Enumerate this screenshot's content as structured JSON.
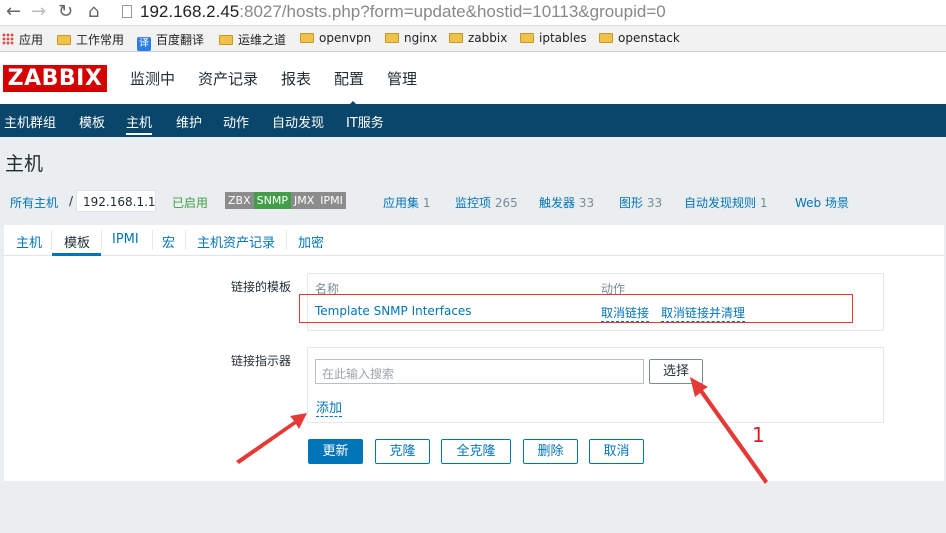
{
  "browser": {
    "url_host": "192.168.2.45",
    "url_rest": ":8027/hosts.php?form=update&hostid=10113&groupid=0",
    "bookmarks": [
      "应用",
      "工作常用",
      "百度翻译",
      "运维之道",
      "openvpn",
      "nginx",
      "zabbix",
      "iptables",
      "openstack"
    ]
  },
  "header": {
    "logo": "ZABBIX",
    "menu": [
      "监测中",
      "资产记录",
      "报表",
      "配置",
      "管理"
    ],
    "active_menu": "配置"
  },
  "submenu": {
    "items": [
      "主机群组",
      "模板",
      "主机",
      "维护",
      "动作",
      "自动发现",
      "IT服务"
    ],
    "active": "主机"
  },
  "page": {
    "title": "主机",
    "breadcrumb_all": "所有主机",
    "breadcrumb_sep": "/",
    "host_name": "192.168.1.1",
    "status": "已启用",
    "availability": [
      "ZBX",
      "SNMP",
      "JMX",
      "IPMI"
    ],
    "links": [
      {
        "label": "应用集",
        "count": "1"
      },
      {
        "label": "监控项",
        "count": "265"
      },
      {
        "label": "触发器",
        "count": "33"
      },
      {
        "label": "图形",
        "count": "33"
      },
      {
        "label": "自动发现规则",
        "count": "1"
      },
      {
        "label": "Web 场景",
        "count": ""
      }
    ]
  },
  "tabs": [
    "主机",
    "模板",
    "IPMI",
    "宏",
    "主机资产记录",
    "加密"
  ],
  "active_tab": "模板",
  "form": {
    "linked_templates_label": "链接的模板",
    "col_name": "名称",
    "col_action": "动作",
    "template_name": "Template SNMP Interfaces",
    "unlink": "取消链接",
    "unlink_clear": "取消链接并清理",
    "link_indicator_label": "链接指示器",
    "search_placeholder": "在此输入搜索",
    "select_button": "选择",
    "add_link": "添加"
  },
  "buttons": {
    "update": "更新",
    "clone": "克隆",
    "full_clone": "全克隆",
    "delete": "删除",
    "cancel": "取消"
  },
  "annotation": {
    "number": "1",
    "color": "#e02020"
  }
}
